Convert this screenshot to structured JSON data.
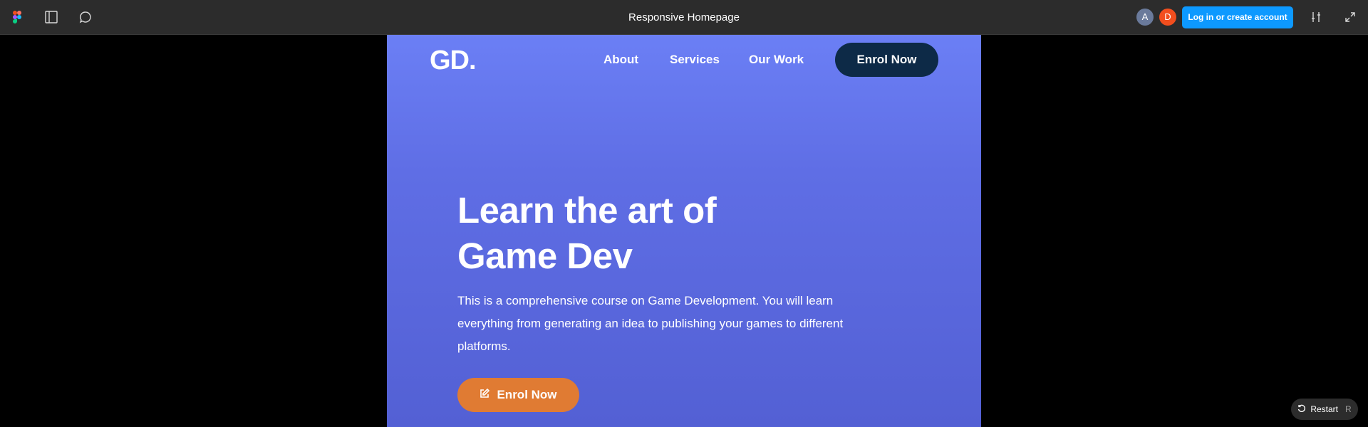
{
  "toolbar": {
    "title": "Responsive Homepage",
    "avatars": [
      "A",
      "D"
    ],
    "avatar_colors": [
      "#6a7a9b",
      "#f24e1e"
    ],
    "login_label": "Log in or create account",
    "icons": [
      "figma-logo-icon",
      "sidebar-toggle-icon",
      "comment-icon",
      "settings-sliders-icon",
      "expand-icon"
    ]
  },
  "site": {
    "logo": "GD.",
    "nav": [
      "About",
      "Services",
      "Our Work"
    ],
    "nav_cta": "Enrol Now",
    "hero": {
      "title_line1": "Learn the art of",
      "title_line2": "Game Dev",
      "description": "This is a comprehensive course on Game Development. You will learn everything from generating an idea to publishing your games to different platforms.",
      "cta": "Enrol Now"
    }
  },
  "restart": {
    "label": "Restart",
    "key": "R"
  },
  "colors": {
    "accent_blue": "#0d99ff",
    "hero_bg": "#6b7ff5",
    "nav_cta_bg": "#0d2a47",
    "cta_orange": "#e07b33"
  }
}
